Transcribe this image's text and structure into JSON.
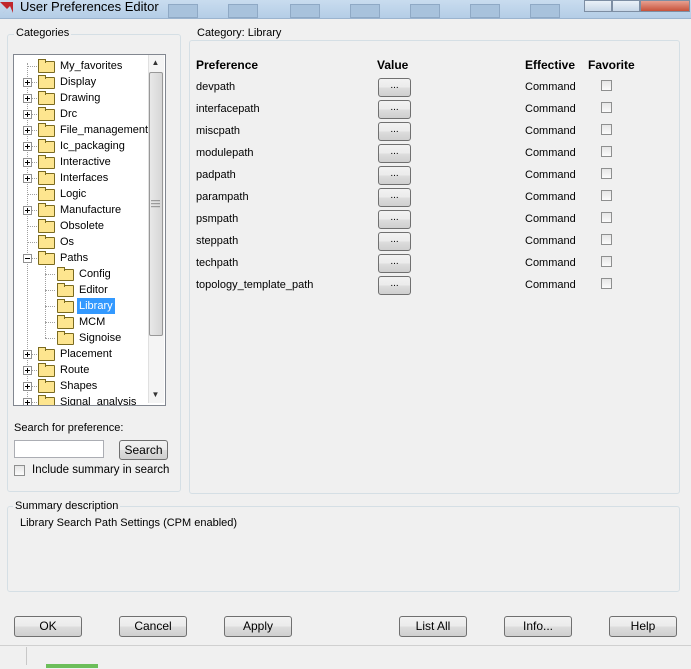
{
  "window": {
    "title": "User Preferences Editor"
  },
  "categories": {
    "group_title": "Categories",
    "tree": [
      {
        "label": "My_favorites",
        "level": 0,
        "expandable": false,
        "selected": false
      },
      {
        "label": "Display",
        "level": 0,
        "expandable": true,
        "selected": false
      },
      {
        "label": "Drawing",
        "level": 0,
        "expandable": true,
        "selected": false
      },
      {
        "label": "Drc",
        "level": 0,
        "expandable": true,
        "selected": false
      },
      {
        "label": "File_management",
        "level": 0,
        "expandable": true,
        "selected": false
      },
      {
        "label": "Ic_packaging",
        "level": 0,
        "expandable": true,
        "selected": false
      },
      {
        "label": "Interactive",
        "level": 0,
        "expandable": true,
        "selected": false
      },
      {
        "label": "Interfaces",
        "level": 0,
        "expandable": true,
        "selected": false
      },
      {
        "label": "Logic",
        "level": 0,
        "expandable": false,
        "selected": false
      },
      {
        "label": "Manufacture",
        "level": 0,
        "expandable": true,
        "selected": false
      },
      {
        "label": "Obsolete",
        "level": 0,
        "expandable": false,
        "selected": false
      },
      {
        "label": "Os",
        "level": 0,
        "expandable": false,
        "selected": false
      },
      {
        "label": "Paths",
        "level": 0,
        "expandable": true,
        "expanded": true,
        "selected": false
      },
      {
        "label": "Config",
        "level": 1,
        "expandable": false,
        "selected": false
      },
      {
        "label": "Editor",
        "level": 1,
        "expandable": false,
        "selected": false
      },
      {
        "label": "Library",
        "level": 1,
        "expandable": false,
        "selected": true
      },
      {
        "label": "MCM",
        "level": 1,
        "expandable": false,
        "selected": false
      },
      {
        "label": "Signoise",
        "level": 1,
        "expandable": false,
        "selected": false
      },
      {
        "label": "Placement",
        "level": 0,
        "expandable": true,
        "selected": false
      },
      {
        "label": "Route",
        "level": 0,
        "expandable": true,
        "selected": false
      },
      {
        "label": "Shapes",
        "level": 0,
        "expandable": true,
        "selected": false
      },
      {
        "label": "Signal_analysis",
        "level": 0,
        "expandable": true,
        "selected": false
      }
    ],
    "search_label": "Search for preference:",
    "search_value": "",
    "search_button": "Search",
    "include_summary_label": "Include summary in search",
    "include_summary_checked": false
  },
  "category_panel": {
    "group_title_prefix": "Category:",
    "category_name": "Library",
    "columns": {
      "preference": "Preference",
      "value": "Value",
      "effective": "Effective",
      "favorite": "Favorite"
    },
    "rows": [
      {
        "name": "devpath",
        "value_button": "...",
        "effective": "Command",
        "favorite": false
      },
      {
        "name": "interfacepath",
        "value_button": "...",
        "effective": "Command",
        "favorite": false
      },
      {
        "name": "miscpath",
        "value_button": "...",
        "effective": "Command",
        "favorite": false
      },
      {
        "name": "modulepath",
        "value_button": "...",
        "effective": "Command",
        "favorite": false
      },
      {
        "name": "padpath",
        "value_button": "...",
        "effective": "Command",
        "favorite": false
      },
      {
        "name": "parampath",
        "value_button": "...",
        "effective": "Command",
        "favorite": false
      },
      {
        "name": "psmpath",
        "value_button": "...",
        "effective": "Command",
        "favorite": false
      },
      {
        "name": "steppath",
        "value_button": "...",
        "effective": "Command",
        "favorite": false
      },
      {
        "name": "techpath",
        "value_button": "...",
        "effective": "Command",
        "favorite": false
      },
      {
        "name": "topology_template_path",
        "value_button": "...",
        "effective": "Command",
        "favorite": false
      }
    ]
  },
  "summary": {
    "group_title": "Summary description",
    "text": "Library Search Path Settings (CPM enabled)"
  },
  "buttons": {
    "ok": "OK",
    "cancel": "Cancel",
    "apply": "Apply",
    "list_all": "List All",
    "info": "Info...",
    "help": "Help"
  },
  "colors": {
    "selection": "#3399ff",
    "folder": "#fde58f",
    "window_bg": "#f0f0f0"
  }
}
